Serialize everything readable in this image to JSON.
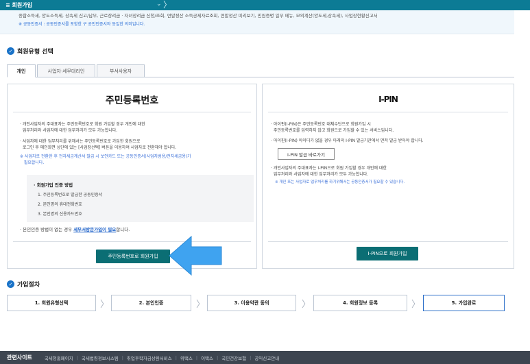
{
  "topbar": {
    "menu_label": "≡  회원가입",
    "chevron": "⌄",
    "separator": "〉"
  },
  "notice": {
    "line1": "종합소득세, 양도소득세, 상속세 신고/납부, 근로장려금 · 자녀장려금 신청/조회, 연말정산 소득공제자료조회, 연말정산 미리보기, 민원증명 일부 메뉴, 모의계산(양도세,상속세), 사업장현황신고서",
    "line2": "※ 공동인증서 : 공동인증서를 포함한 구 공인인증서와 동일한 의미입니다."
  },
  "member_type": {
    "title": "회원유형 선택",
    "tabs": [
      {
        "label": "개인"
      },
      {
        "label": "사업자·세무대리인"
      },
      {
        "label": "부서사용자"
      }
    ]
  },
  "left_panel": {
    "title": "주민등록번호",
    "p1": "· 개인사업자의 주대표자는 주민등록번호로 회원 가입할 경우 개인에 대한\n  업무처리와 사업자에 대한 업무처리가 모두 가능합니다.",
    "p2": "· 사업자에 대한 업무처리를 위해서는 주민등록번호로 가입한 회원으로\n  로그인 후 메인화면 상단에 있는 [사업장선택] 버튼을 이용하여 사업자로 전환해야 합니다.",
    "p3": "※ 사업자로 전환한 후 전자세금계산서 발급 시 보안카드 또는 공동인증서(사업자범용/전자세금용)가\n   필요합니다.",
    "methods_title": "· 회원가입 인증 방법",
    "methods": [
      "1. 주민등록번호로 발급한 공동인증서",
      "2. 본인명의 휴대전화번호",
      "3. 본인명의 신용카드번호"
    ],
    "note_prefix": "· 본인인증 방법이 없는 경우 ",
    "note_link": "세무서방문가입이 필요",
    "note_suffix": "합니다.",
    "button": "주민등록번호로 회원가입"
  },
  "right_panel": {
    "title": "I-PIN",
    "p1": "· 아이핀(I-PIN)은 주민등록번호 대체수단으로 회원가입 시\n  주민등록번호를 입력하지 않고 회원으로 가입할 수 있는 서비스입니다.",
    "p2": "· 아이핀(I-PIN) 아이디가 없을 경우 아래의 I-PIN 발급기관에서 먼저 발급 받아야 합니다.",
    "ipin_issue_button": "I-PIN 발급 바로가기",
    "p3": "· 개인사업자의 주대표자는 I-PIN으로 회원 가입할 경우 개인에 대한\n  업무처리와 사업자에 대한 업무처리가 모두 가능합니다.",
    "p4": "※ 개인 또는 사업자로 업무처리를 하기위해서는 공동인증서가 필요할 수 있습니다.",
    "button": "I-PIN으로 회원가입"
  },
  "process": {
    "title": "가입절차",
    "steps": [
      "1. 회원유형선택",
      "2. 본인인증",
      "3. 이용약관 동의",
      "4. 회원정보 등록",
      "5. 가입완료"
    ]
  },
  "footer": {
    "title": "관련사이트",
    "links": [
      "국세청홈페이지",
      "국세법령정보시스템",
      "취업후학자금상환서비스",
      "위택스",
      "이택스",
      "국민건강보험",
      "공익신고안내"
    ]
  },
  "colors": {
    "topbar": "#0c7b95",
    "primary_button": "#0b6e74",
    "arrow": "#3fa3f0",
    "footer": "#3d4550"
  }
}
